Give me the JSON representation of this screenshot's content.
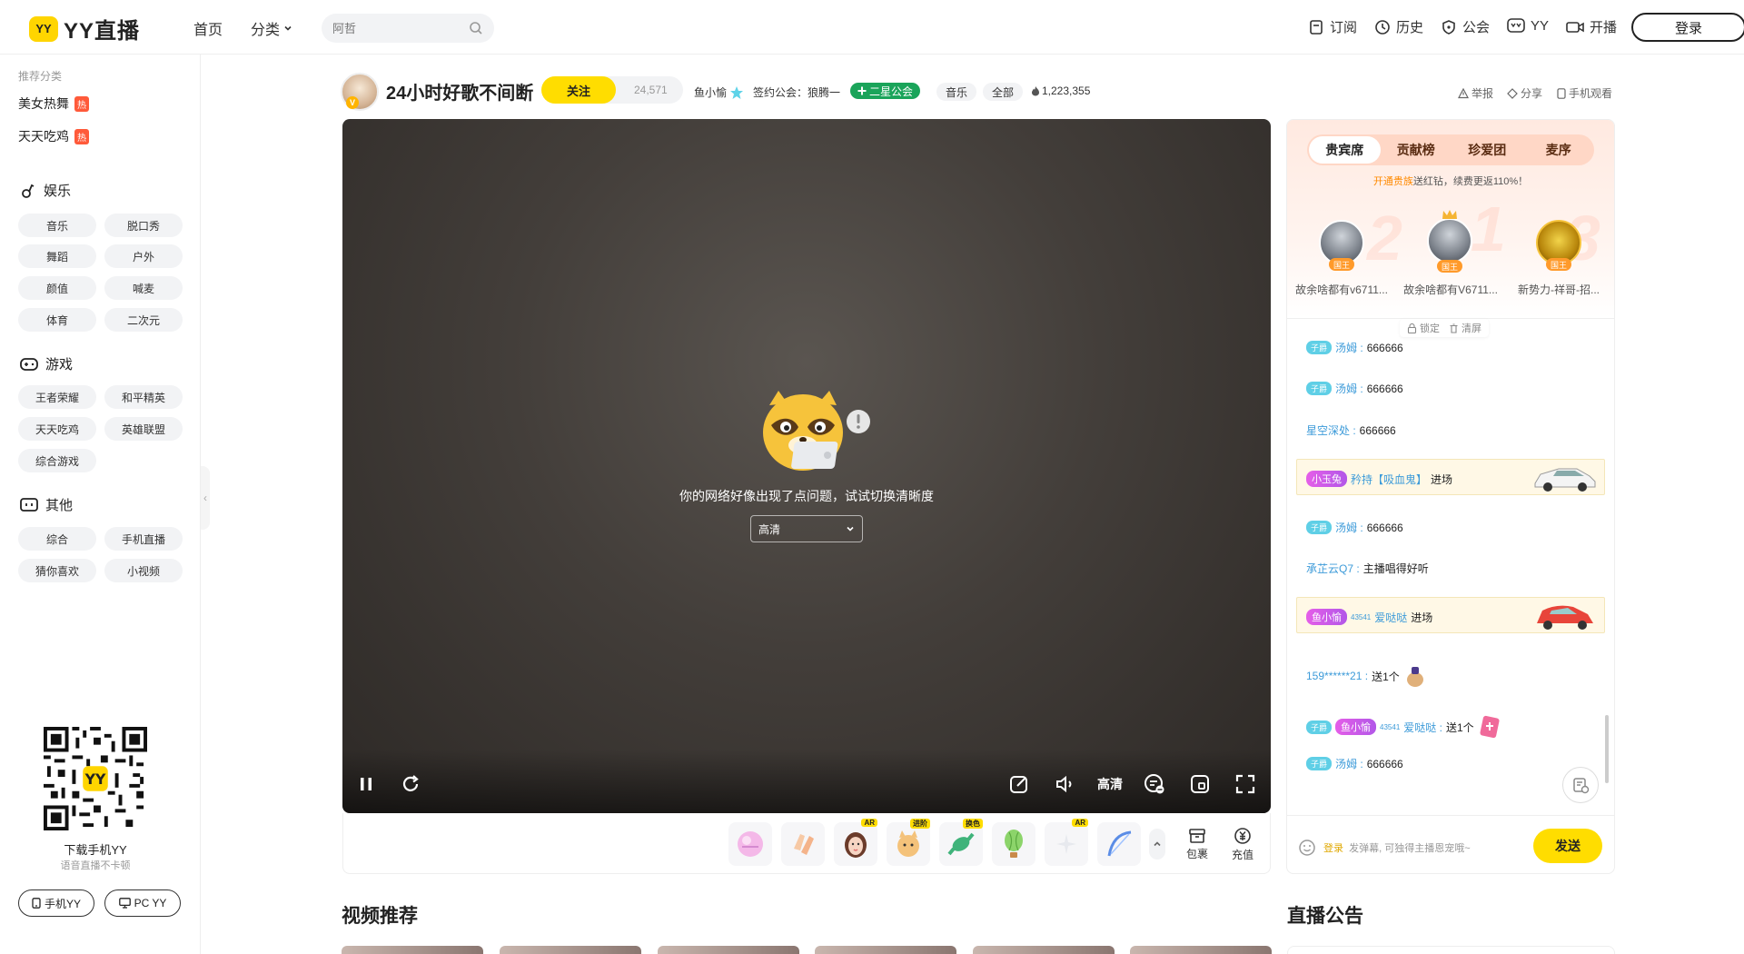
{
  "header": {
    "logo_badge": "YY",
    "logo_text": "YY直播",
    "nav": [
      {
        "label": "首页"
      },
      {
        "label": "分类"
      }
    ],
    "search_placeholder": "阿哲",
    "right": [
      {
        "label": "订阅",
        "icon": "bookmark-icon"
      },
      {
        "label": "历史",
        "icon": "clock-icon"
      },
      {
        "label": "公会",
        "icon": "shield-icon"
      },
      {
        "label": "YY",
        "icon": "yy-icon"
      },
      {
        "label": "开播",
        "icon": "camera-icon"
      }
    ],
    "login": "登录"
  },
  "sidebar": {
    "recommend_title": "推荐分类",
    "hot_tag": "热",
    "recommend": [
      {
        "label": "美女热舞"
      },
      {
        "label": "天天吃鸡"
      }
    ],
    "sections": [
      {
        "title": "娱乐",
        "icon": "music-note-icon",
        "items": [
          "音乐",
          "脱口秀",
          "舞蹈",
          "户外",
          "颜值",
          "喊麦",
          "体育",
          "二次元"
        ]
      },
      {
        "title": "游戏",
        "icon": "gamepad-icon",
        "items": [
          "王者荣耀",
          "和平精英",
          "天天吃鸡",
          "英雄联盟",
          "综合游戏"
        ]
      },
      {
        "title": "其他",
        "icon": "tv-icon",
        "items": [
          "综合",
          "手机直播",
          "猜你喜欢",
          "小视频"
        ]
      }
    ],
    "download_title": "下载手机YY",
    "download_sub": "语音直播不卡顿",
    "btn_mobile": "手机YY",
    "btn_pc": "PC YY"
  },
  "room": {
    "title": "24小时好歌不间断",
    "follow": "关注",
    "follow_count": "24,571",
    "anchor": "鱼小愉",
    "guild": "签约公会：狼腾一",
    "star_tag": "二星公会",
    "tags": [
      "音乐",
      "全部"
    ],
    "heat": "1,223,355",
    "report": "举报",
    "share": "分享",
    "mobile_watch": "手机观看"
  },
  "player": {
    "error_text": "你的网络好像出现了点问题，试试切换清晰度",
    "quality_selected": "高清",
    "quality_label": "高清"
  },
  "gifts": {
    "badges": [
      "AR",
      "进阶",
      "换色",
      "AR"
    ],
    "bag": "包裹",
    "recharge": "充值"
  },
  "panel": {
    "tabs": [
      "贵宾席",
      "贡献榜",
      "珍爱团",
      "麦序"
    ],
    "vip_note_hl": "开通贵族",
    "vip_note": "送红钻，续费更返110%！",
    "vip_tag": "国王",
    "vips": [
      {
        "rank": "2",
        "name": "故余啥都有v6711..."
      },
      {
        "rank": "1",
        "name": "故余啥都有V6711..."
      },
      {
        "rank": "3",
        "name": "新势力-祥哥-招..."
      }
    ],
    "lock": "锁定",
    "clear": "清屏",
    "level_tag": "子爵",
    "chat": [
      {
        "level": true,
        "nick": "汤姆 :",
        "text": "666666"
      },
      {
        "level": true,
        "nick": "汤姆 :",
        "text": "666666"
      },
      {
        "level": false,
        "nick": "星空深处 :",
        "text": "666666"
      },
      {
        "enter": true,
        "badge": "小玉兔",
        "nick": "矜持【吸血鬼】",
        "text": "进场"
      },
      {
        "level": true,
        "nick": "汤姆 :",
        "text": "666666"
      },
      {
        "level": false,
        "nick": "承芷云Q7 :",
        "text": "主播唱得好听"
      },
      {
        "enter": true,
        "badge": "鱼小愉",
        "sup": "43541",
        "nick": "爱哒哒",
        "text": "进场"
      },
      {
        "level": false,
        "nick": "159******21 :",
        "text": "送1个"
      },
      {
        "level": true,
        "badge": "鱼小愉",
        "sup": "43541",
        "nick": "爱哒哒 :",
        "text": "送1个"
      },
      {
        "level": true,
        "nick": "汤姆 :",
        "text": "666666"
      }
    ],
    "input_login": "登录",
    "input_placeholder": "发弹幕, 可独得主播恩宠哦~",
    "send": "发送"
  },
  "sections": {
    "video_recommend": "视频推荐",
    "announcement": "直播公告"
  },
  "colors": {
    "brand_yellow": "#ffdd00",
    "nick_blue": "#3d9bd9",
    "green_tag": "#1aa45a"
  }
}
